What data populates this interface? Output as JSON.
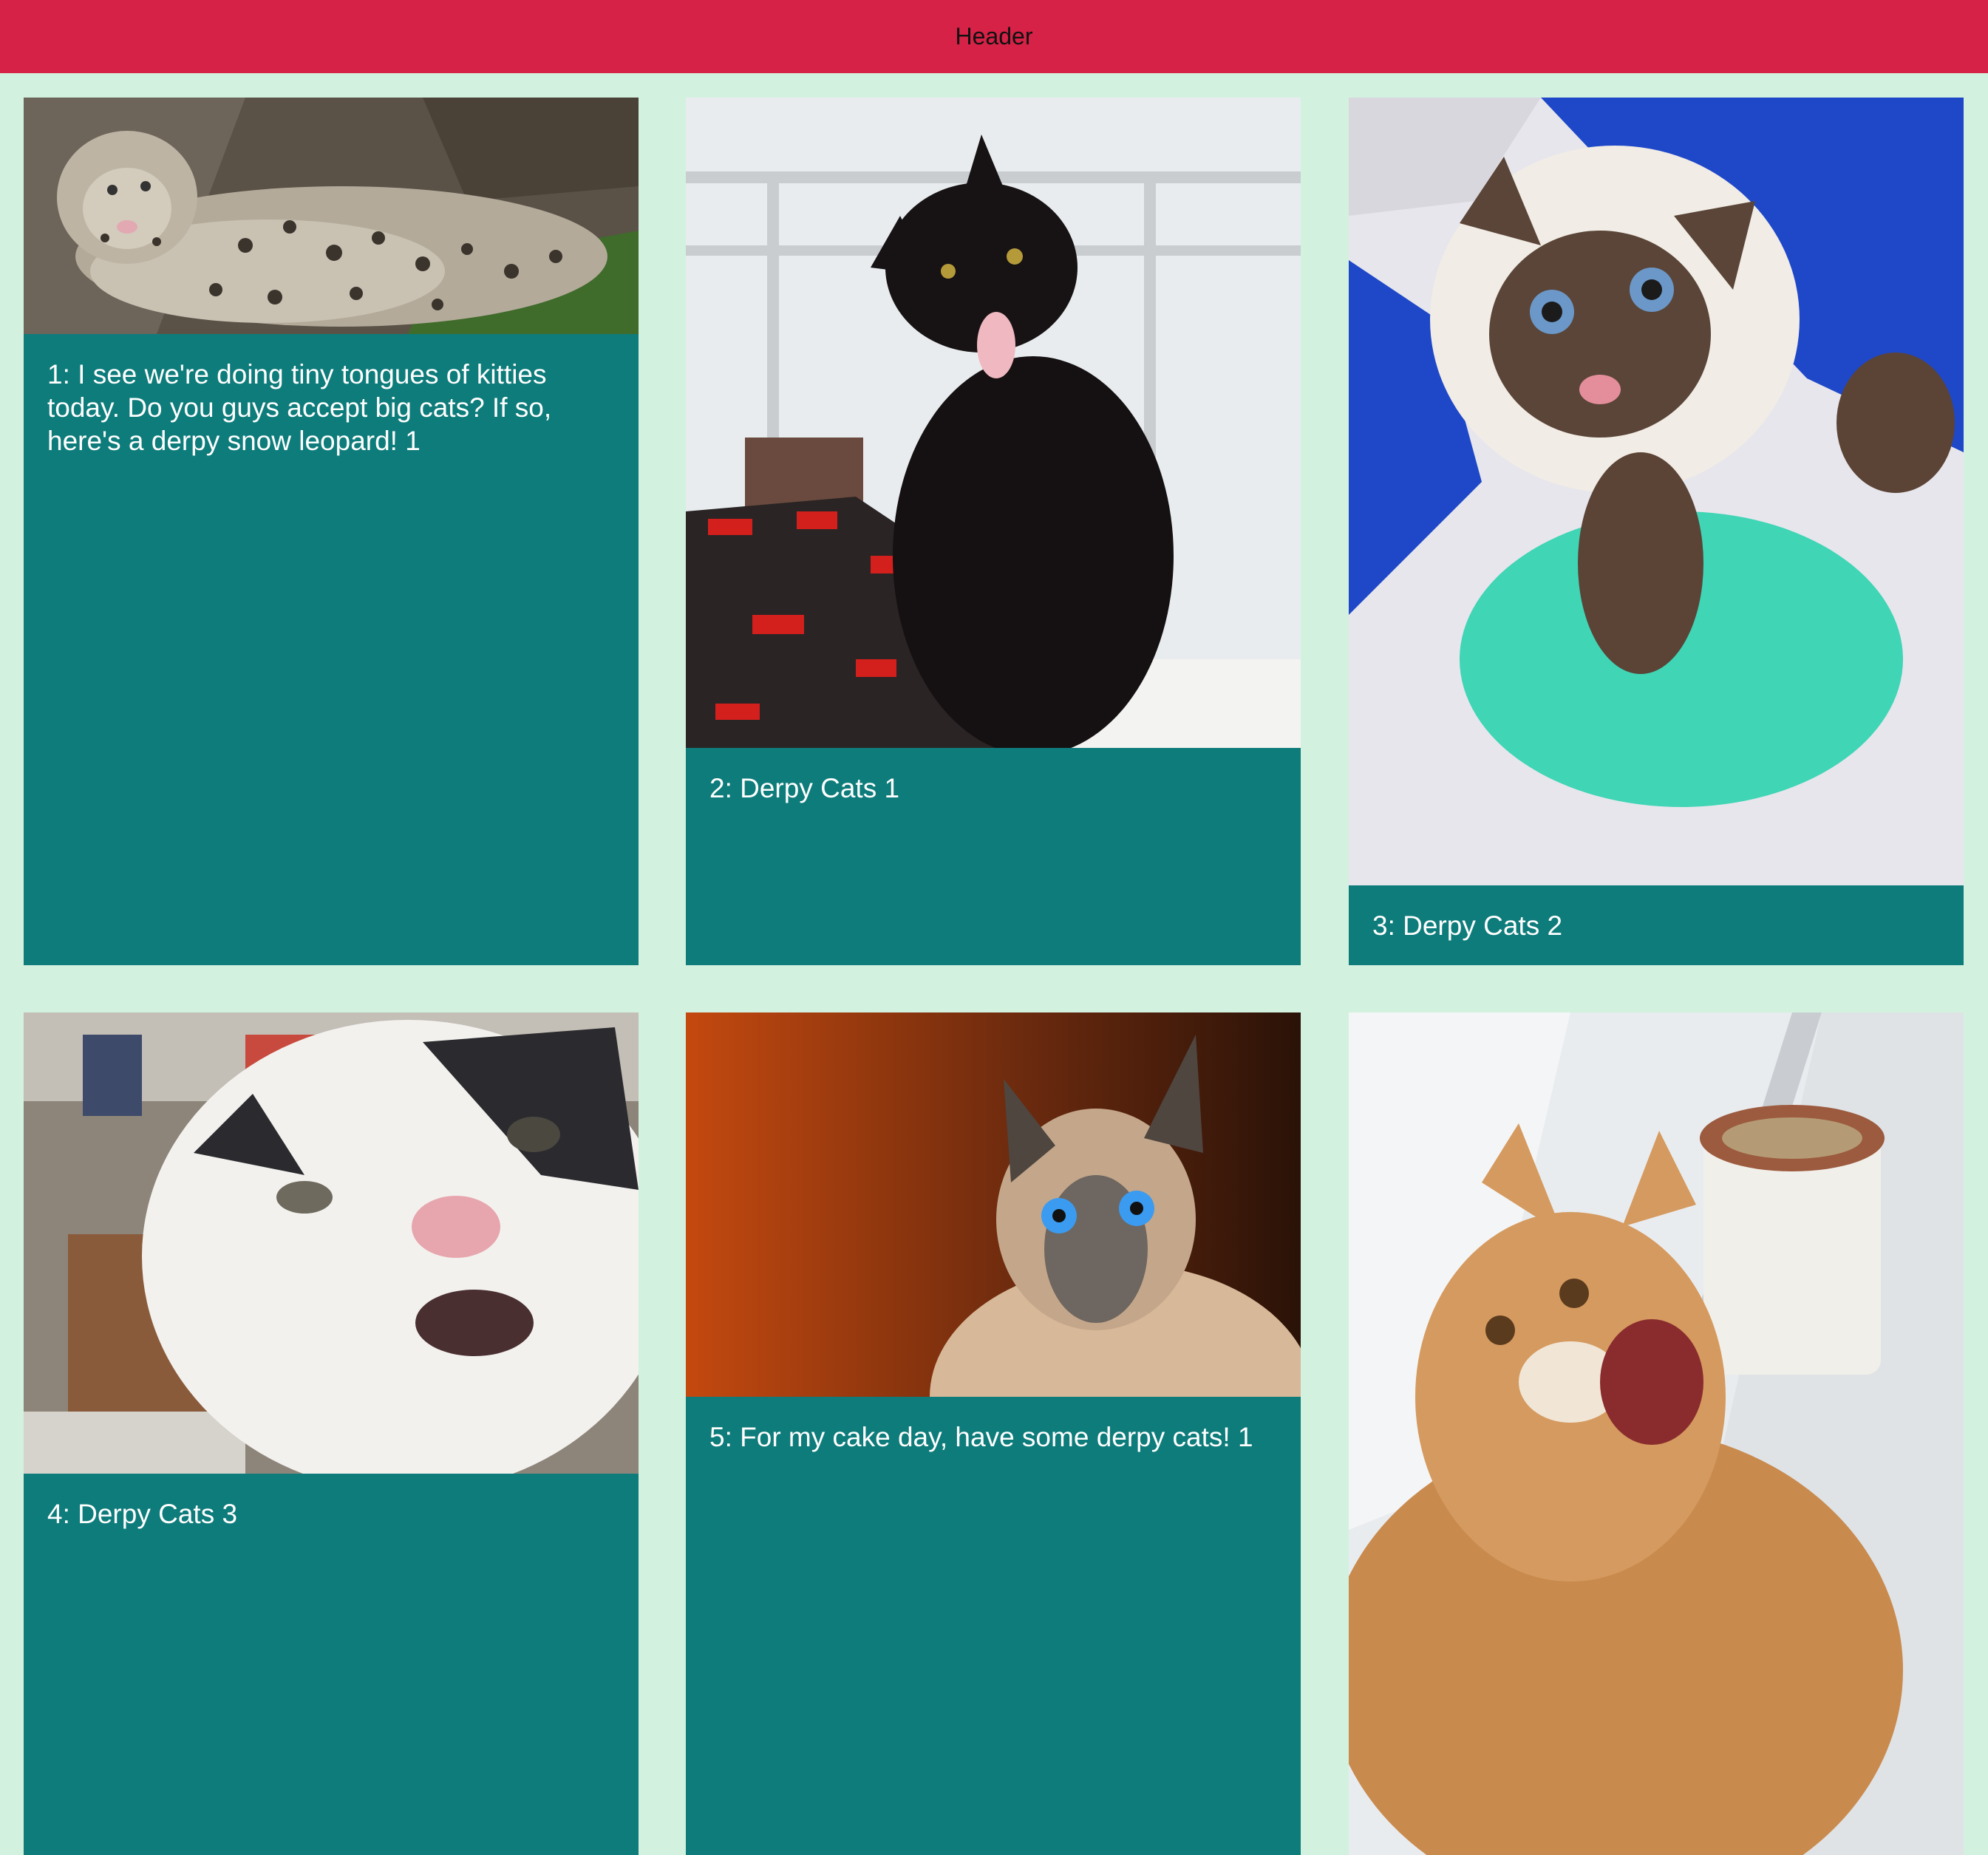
{
  "header": {
    "title": "Header"
  },
  "cards": [
    {
      "caption": "1: I see we're doing tiny tongues of kitties today. Do you guys accept big cats? If so, here's a derpy snow leopard! 1",
      "image": "snow-leopard-photo"
    },
    {
      "caption": "2: Derpy Cats 1",
      "image": "black-cat-photo"
    },
    {
      "caption": "3: Derpy Cats 2",
      "image": "siamese-cat-photo"
    },
    {
      "caption": "4: Derpy Cats 3",
      "image": "white-cat-closeup-photo"
    },
    {
      "caption": "5: For my cake day, have some derpy cats! 1",
      "image": "blue-eyed-cat-photo"
    },
    {
      "caption": "",
      "image": "orange-cat-photo"
    }
  ],
  "colors": {
    "header_bg": "#d62246",
    "page_bg": "#d3f1df",
    "card_bg": "#0e7c7b",
    "caption_text": "#ffffff"
  }
}
